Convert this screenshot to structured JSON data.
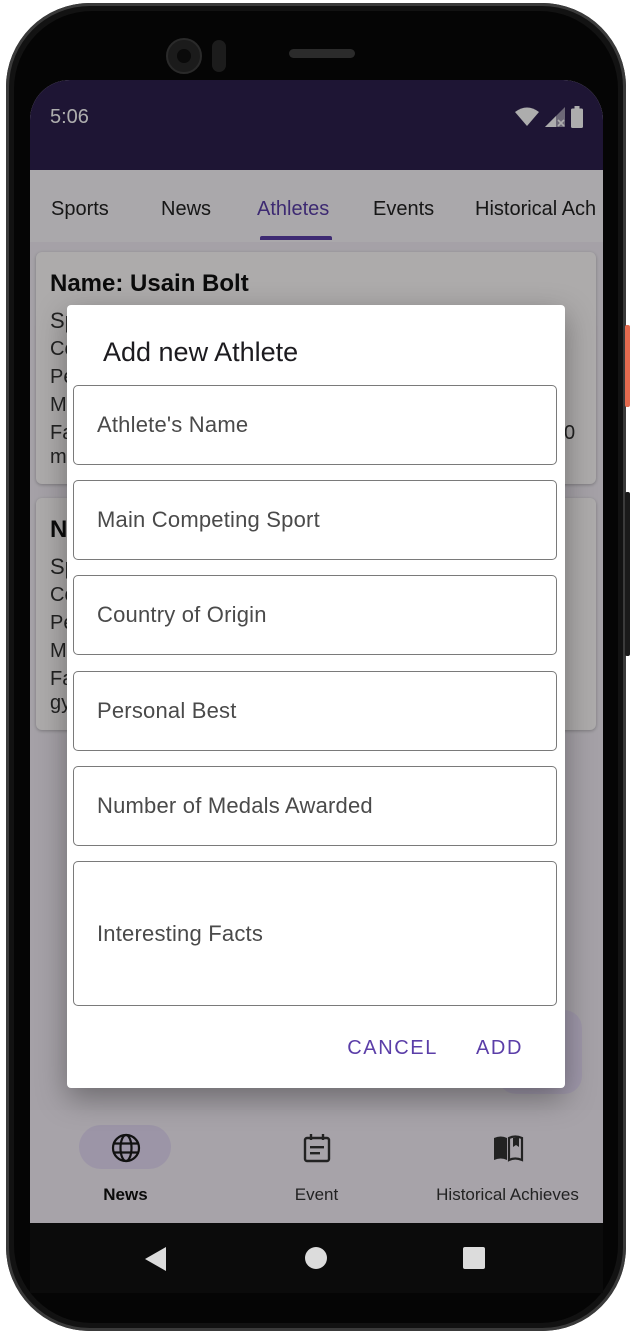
{
  "status_bar": {
    "time": "5:06"
  },
  "tabs": [
    {
      "label": "Sports"
    },
    {
      "label": "News"
    },
    {
      "label": "Athletes"
    },
    {
      "label": "Events"
    },
    {
      "label": "Historical Ach"
    }
  ],
  "cards": [
    {
      "title": "Name: Usain Bolt",
      "lines": [
        "Sp",
        "Co",
        "Pe",
        "M",
        "Fa",
        "m"
      ],
      "trailing": "0"
    },
    {
      "title": "N",
      "lines": [
        "Sp",
        "Co",
        "Pe",
        "M",
        "Fa",
        "gy"
      ]
    }
  ],
  "dialog": {
    "title": "Add new Athlete",
    "fields": [
      {
        "label": "Athlete's Name"
      },
      {
        "label": "Main Competing Sport"
      },
      {
        "label": "Country of Origin"
      },
      {
        "label": "Personal Best"
      },
      {
        "label": "Number of Medals Awarded"
      },
      {
        "label": "Interesting Facts"
      }
    ],
    "cancel_label": "CANCEL",
    "add_label": "ADD"
  },
  "bottom_nav": [
    {
      "label": "News",
      "icon": "globe-icon"
    },
    {
      "label": "Event",
      "icon": "calendar-icon"
    },
    {
      "label": "Historical Achieves",
      "icon": "book-icon"
    }
  ],
  "colors": {
    "accent": "#5b3ea8",
    "status_bar": "#2d1f4d",
    "scrim": "rgba(0,0,0,0.32)"
  }
}
